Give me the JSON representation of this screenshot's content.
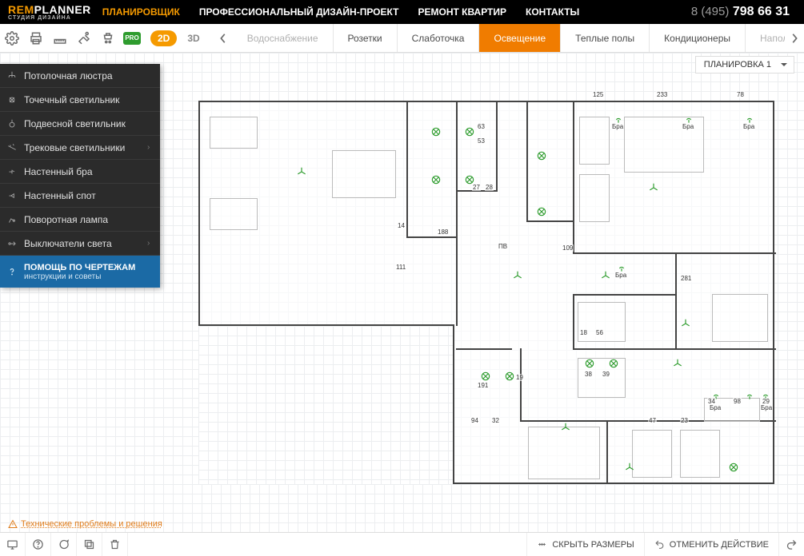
{
  "brand": {
    "prefix": "REM",
    "suffix": "PLANNER",
    "sub": "СТУДИЯ ДИЗАЙНА"
  },
  "nav": {
    "items": [
      "ПЛАНИРОВЩИК",
      "ПРОФЕССИОНАЛЬНЫЙ ДИЗАЙН-ПРОЕКТ",
      "РЕМОНТ КВАРТИР",
      "КОНТАКТЫ"
    ],
    "active_index": 0
  },
  "phone": {
    "prefix": "8 (495)",
    "number": "798 66 31"
  },
  "toolbar": {
    "pro_label": "PRO",
    "view_modes": {
      "two_d": "2D",
      "three_d": "3D",
      "active": "2D"
    },
    "system_tabs": [
      "Водоснабжение",
      "Розетки",
      "Слаботочка",
      "Освещение",
      "Теплые полы",
      "Кондиционеры",
      "Напол"
    ],
    "system_active_index": 3
  },
  "plan_selector": {
    "label": "ПЛАНИРОВКА 1"
  },
  "tool_panel": {
    "items": [
      {
        "label": "Потолочная люстра",
        "icon": "chandelier",
        "expandable": false
      },
      {
        "label": "Точечный светильник",
        "icon": "spot",
        "expandable": false
      },
      {
        "label": "Подвесной светильник",
        "icon": "pendant",
        "expandable": false
      },
      {
        "label": "Трековые светильники",
        "icon": "track",
        "expandable": true
      },
      {
        "label": "Настенный бра",
        "icon": "sconce",
        "expandable": false
      },
      {
        "label": "Настенный спот",
        "icon": "wallspot",
        "expandable": false
      },
      {
        "label": "Поворотная лампа",
        "icon": "swivel",
        "expandable": false
      },
      {
        "label": "Выключатели света",
        "icon": "switch",
        "expandable": true
      }
    ],
    "help": {
      "title": "ПОМОЩЬ ПО ЧЕРТЕЖАМ",
      "sub": "инструкции и советы"
    }
  },
  "dimensions": {
    "top_125": "125",
    "top_233": "233",
    "top_78": "78",
    "d_63": "63",
    "d_53": "53",
    "d_27": "27",
    "d_28": "28",
    "d_14": "14",
    "d_188": "188",
    "d_111": "111",
    "d_109": "109",
    "d_281": "281",
    "d_18": "18",
    "d_56": "56",
    "d_38": "38",
    "d_39": "39",
    "d_191": "191",
    "d_19": "19",
    "d_34": "34",
    "d_98": "98",
    "d_29": "29",
    "d_94": "94",
    "d_32": "32",
    "d_47": "47",
    "d_23": "23",
    "bra": "Бра",
    "pv": "ПВ"
  },
  "hint_link": "Технические проблемы и решения",
  "footer": {
    "hide_sizes": "СКРЫТЬ РАЗМЕРЫ",
    "undo": "ОТМЕНИТЬ ДЕЙСТВИЕ"
  }
}
